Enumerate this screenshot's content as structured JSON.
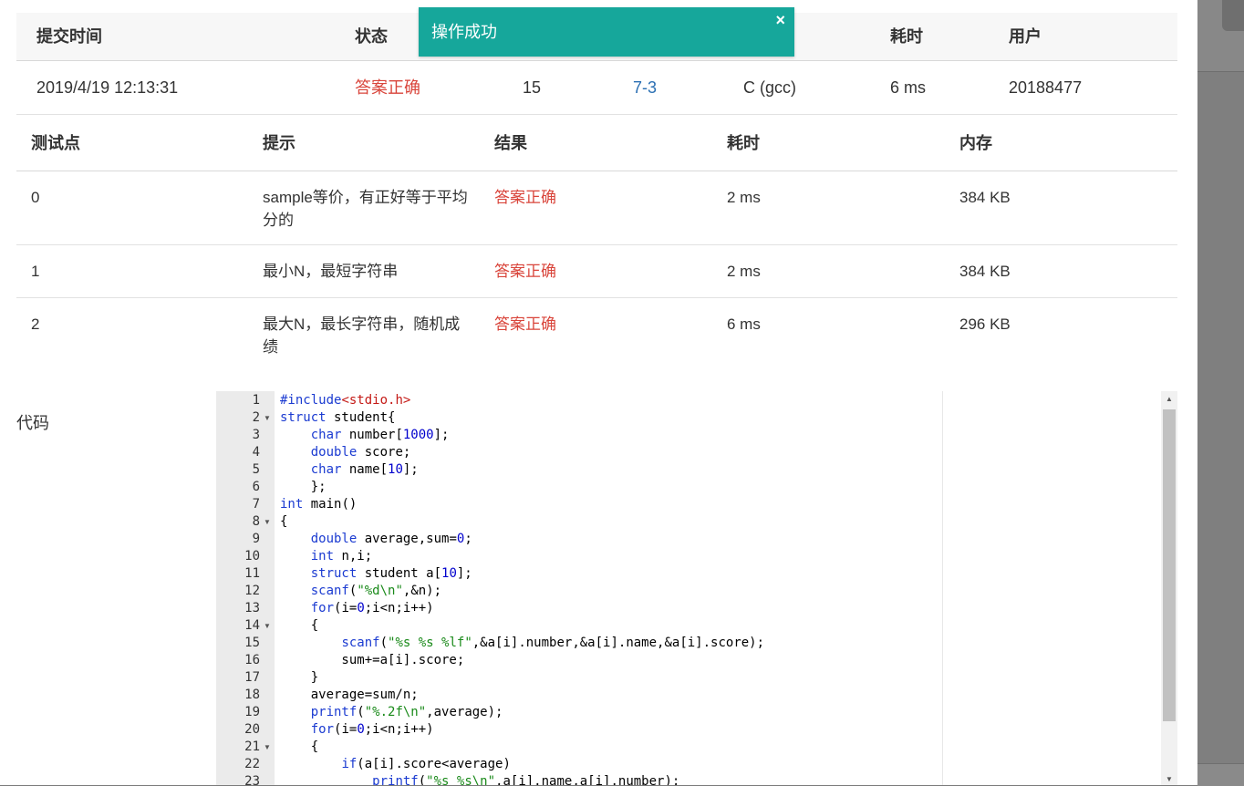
{
  "submission": {
    "headers": [
      "提交时间",
      "状态",
      "",
      "",
      "",
      "耗时",
      "用户"
    ],
    "row": {
      "time": "2019/4/19 12:13:31",
      "status": "答案正确",
      "score": "15",
      "problem": "7-3",
      "compiler": "C (gcc)",
      "duration": "6 ms",
      "user": "20188477"
    }
  },
  "toast": {
    "message": "操作成功",
    "close": "×"
  },
  "testcases": {
    "headers": [
      "测试点",
      "提示",
      "结果",
      "耗时",
      "内存"
    ],
    "rows": [
      {
        "id": "0",
        "hint": "sample等价，有正好等于平均分的",
        "result": "答案正确",
        "time": "2 ms",
        "memory": "384 KB"
      },
      {
        "id": "1",
        "hint": "最小N，最短字符串",
        "result": "答案正确",
        "time": "2 ms",
        "memory": "384 KB"
      },
      {
        "id": "2",
        "hint": "最大N，最长字符串，随机成绩",
        "result": "答案正确",
        "time": "6 ms",
        "memory": "296 KB"
      }
    ]
  },
  "code_section": {
    "label": "代码",
    "lines": [
      "#include<stdio.h>",
      "struct student{",
      "    char number[1000];",
      "    double score;",
      "    char name[10];",
      "    };",
      "int main()",
      "{",
      "    double average,sum=0;",
      "    int n,i;",
      "    struct student a[10];",
      "    scanf(\"%d\\n\",&n);",
      "    for(i=0;i<n;i++)",
      "    {",
      "        scanf(\"%s %s %lf\",&a[i].number,&a[i].name,&a[i].score);",
      "        sum+=a[i].score;",
      "    }",
      "    average=sum/n;",
      "    printf(\"%.2f\\n\",average);",
      "    for(i=0;i<n;i++)",
      "    {",
      "        if(a[i].score<average)",
      "            printf(\"%s %s\\n\",a[i].name,a[i].number);"
    ],
    "fold_lines": [
      2,
      8,
      14,
      21
    ],
    "colors": {
      "keyword": "#1b3bd1",
      "string": "#1a8a1a",
      "number": "#0000cd",
      "include": "#c41a16"
    }
  },
  "colors": {
    "toast_bg": "#16a79b",
    "status_red": "#d9453b",
    "link_blue": "#2a6fb3"
  }
}
